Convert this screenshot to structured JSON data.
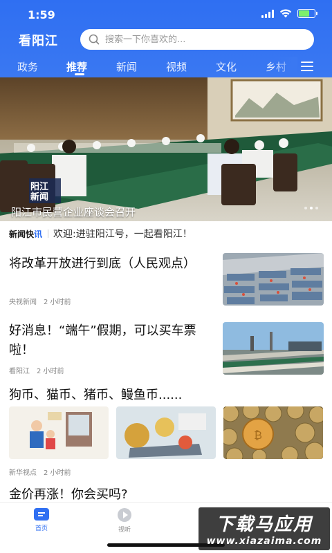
{
  "status": {
    "time": "1:59"
  },
  "header": {
    "brand": "看阳江",
    "search_placeholder": "搜索一下你喜欢的...",
    "tabs": [
      {
        "label": "政务"
      },
      {
        "label": "推荐",
        "active": true
      },
      {
        "label": "新闻"
      },
      {
        "label": "视频"
      },
      {
        "label": "文化"
      },
      {
        "label": "乡村"
      }
    ],
    "menu_icon": "menu-icon"
  },
  "banner": {
    "caption": "阳江市民营企业座谈会召开",
    "logo_line1": "阳江",
    "logo_line2": "新闻",
    "slides": 3,
    "current_slide": 2
  },
  "flash": {
    "tag_a": "新闻快",
    "tag_b": "讯",
    "text": "欢迎:进驻阳江号，一起看阳江！"
  },
  "articles": [
    {
      "title": "将改革开放进行到底（人民观点）",
      "source": "央视新闻",
      "time": "2 小时前"
    },
    {
      "title": "好消息！“端午”假期，可以买车票啦！",
      "source": "看阳江",
      "time": "2 小时前"
    },
    {
      "title": "狗币、猫币、猪币、鳗鱼币......",
      "source": "新华视点",
      "time": "2 小时前"
    },
    {
      "title": "金价再涨！你会买吗?"
    }
  ],
  "bottom_nav": [
    {
      "label": "首页",
      "icon": "home-icon",
      "active": true
    },
    {
      "label": "视听",
      "icon": "play-icon"
    }
  ],
  "watermark": {
    "cn": "下载马应用",
    "en": "www.xiazaima.com"
  },
  "colors": {
    "primary": "#2f6ff2",
    "text": "#111111",
    "meta": "#888888"
  }
}
